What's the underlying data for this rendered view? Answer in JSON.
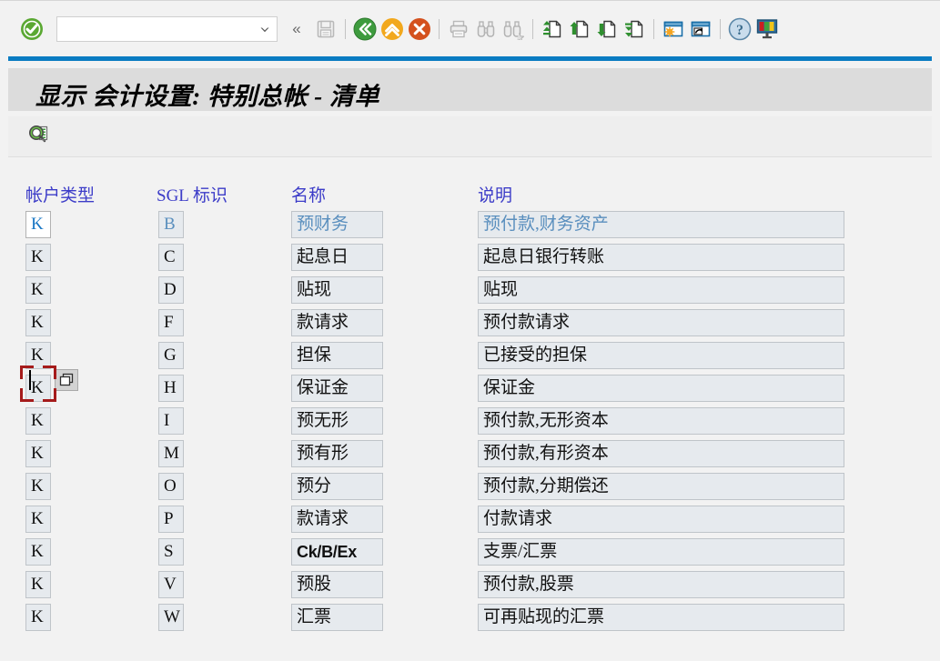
{
  "toolbar": {
    "enter_icon": "green-check-icon",
    "command_value": "",
    "command_placeholder": "",
    "collapse_label": "«",
    "items": [
      {
        "name": "save-button",
        "icon": "save-icon",
        "enabled": false
      },
      {
        "name": "back-button",
        "icon": "back-green-icon",
        "enabled": true
      },
      {
        "name": "exit-button",
        "icon": "exit-yellow-icon",
        "enabled": true
      },
      {
        "name": "cancel-button",
        "icon": "cancel-red-icon",
        "enabled": true
      },
      {
        "name": "print-button",
        "icon": "printer-icon",
        "enabled": false
      },
      {
        "name": "find-button",
        "icon": "binoculars-icon",
        "enabled": false
      },
      {
        "name": "find-next-button",
        "icon": "binoculars-plus-icon",
        "enabled": false
      },
      {
        "name": "first-page-button",
        "icon": "first-page-icon",
        "enabled": true
      },
      {
        "name": "previous-page-button",
        "icon": "previous-page-icon",
        "enabled": true
      },
      {
        "name": "next-page-button",
        "icon": "next-page-icon",
        "enabled": true
      },
      {
        "name": "last-page-button",
        "icon": "last-page-icon",
        "enabled": true
      },
      {
        "name": "create-session-button",
        "icon": "create-session-icon",
        "enabled": true
      },
      {
        "name": "create-shortcut-button",
        "icon": "create-shortcut-icon",
        "enabled": true
      },
      {
        "name": "help-button",
        "icon": "help-question-icon",
        "enabled": true
      },
      {
        "name": "customize-layout-button",
        "icon": "customize-layout-icon",
        "enabled": true
      }
    ]
  },
  "header": {
    "title": "显示 会计设置: 特别总帐 - 清单"
  },
  "app_toolbar": {
    "details_label": "details-magnifier-icon"
  },
  "table": {
    "columns": [
      {
        "key": "account_type",
        "label": "帐户类型"
      },
      {
        "key": "sgl_indicator",
        "label": "SGL 标识"
      },
      {
        "key": "name",
        "label": "名称"
      },
      {
        "key": "description",
        "label": "说明"
      }
    ],
    "rows": [
      {
        "account_type": "K",
        "sgl_indicator": "B",
        "name": "预财务",
        "description": "预付款,财务资产"
      },
      {
        "account_type": "K",
        "sgl_indicator": "C",
        "name": "起息日",
        "description": "起息日银行转账"
      },
      {
        "account_type": "K",
        "sgl_indicator": "D",
        "name": "贴现",
        "description": "贴现"
      },
      {
        "account_type": "K",
        "sgl_indicator": "F",
        "name": "款请求",
        "description": "预付款请求"
      },
      {
        "account_type": "K",
        "sgl_indicator": "G",
        "name": "担保",
        "description": "已接受的担保"
      },
      {
        "account_type": "K",
        "sgl_indicator": "H",
        "name": "保证金",
        "description": "保证金"
      },
      {
        "account_type": "K",
        "sgl_indicator": "I",
        "name": "预无形",
        "description": "预付款,无形资本"
      },
      {
        "account_type": "K",
        "sgl_indicator": "M",
        "name": "预有形",
        "description": "预付款,有形资本"
      },
      {
        "account_type": "K",
        "sgl_indicator": "O",
        "name": "预分",
        "description": "预付款,分期偿还"
      },
      {
        "account_type": "K",
        "sgl_indicator": "P",
        "name": "款请求",
        "description": "付款请求"
      },
      {
        "account_type": "K",
        "sgl_indicator": "S",
        "name": "Ck/B/Ex",
        "description": "支票/汇票"
      },
      {
        "account_type": "K",
        "sgl_indicator": "V",
        "name": "预股",
        "description": "预付款,股票"
      },
      {
        "account_type": "K",
        "sgl_indicator": "W",
        "name": "汇票",
        "description": "可再贴现的汇票"
      }
    ],
    "focused_cell": {
      "row": 0,
      "column": "account_type",
      "value": "K"
    },
    "multi_select_icon": "multiple-selection-icon"
  },
  "colors": {
    "accent_blue": "#0a7cc2",
    "header_text": "#3c3cc8",
    "cell_background": "#e6eaee",
    "cell_border": "#bfc4c9",
    "focus_marker": "#a51b1b",
    "readonly_text": "#5a8fbe",
    "title_band": "#dcdcdc",
    "page_background": "#f2f2f2"
  }
}
